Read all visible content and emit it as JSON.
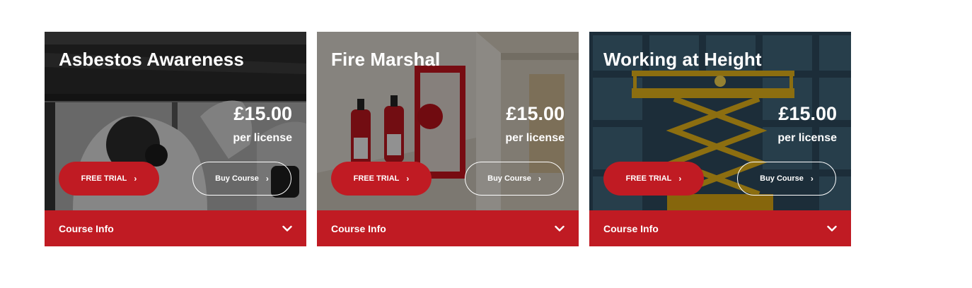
{
  "cards": [
    {
      "title": "Asbestos Awareness",
      "price": "£15.00",
      "per": "per license",
      "trial_label": "FREE TRIAL",
      "buy_label": "Buy Course",
      "info_label": "Course Info",
      "image": "worker-in-hazmat-suit"
    },
    {
      "title": "Fire Marshal",
      "price": "£15.00",
      "per": "per license",
      "trial_label": "FREE TRIAL",
      "buy_label": "Buy Course",
      "info_label": "Course Info",
      "image": "fire-extinguishers-hallway"
    },
    {
      "title": "Working at Height",
      "price": "£15.00",
      "per": "per license",
      "trial_label": "FREE TRIAL",
      "buy_label": "Buy Course",
      "info_label": "Course Info",
      "image": "scissor-lift-building"
    }
  ],
  "icons": {
    "button_arrow": "chevron-right-icon",
    "info_toggle": "chevron-down-icon"
  },
  "colors": {
    "brand_red": "#c01b23",
    "text": "#ffffff",
    "page_background": "#ffffff"
  }
}
